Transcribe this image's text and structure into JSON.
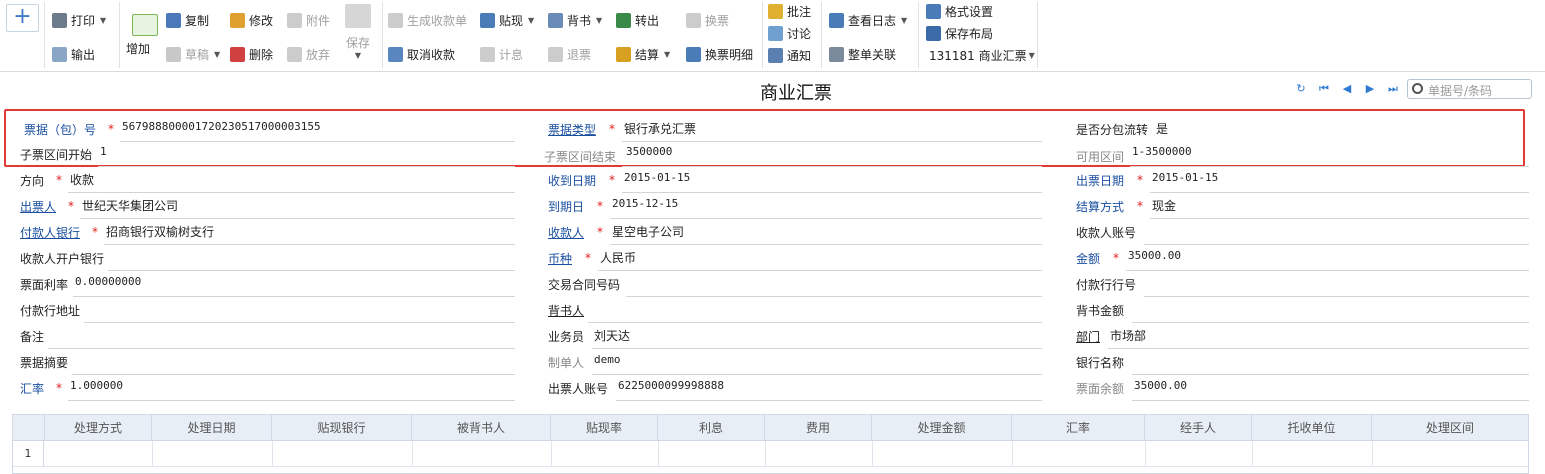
{
  "toolbar": {
    "print": "打印",
    "export": "输出",
    "add": "增加",
    "copy": "复制",
    "draft": "草稿",
    "modify": "修改",
    "delete": "删除",
    "attachment": "附件",
    "abandon": "放弃",
    "save": "保存",
    "gen_receipt": "生成收款单",
    "cancel_receipt": "取消收款",
    "discount": "贴现",
    "interest": "计息",
    "endorse": "背书",
    "return_bill": "退票",
    "transfer_out": "转出",
    "settle": "结算",
    "exchange": "换票",
    "exchange_detail": "换票明细",
    "annotate": "批注",
    "discuss": "讨论",
    "notify": "通知",
    "view_log": "查看日志",
    "full_link": "整单关联",
    "format_setting": "格式设置",
    "save_layout": "保存布局",
    "template": "131181 商业汇票"
  },
  "page_title": "商业汇票",
  "search": {
    "placeholder": "单据号/条码"
  },
  "fields": {
    "bill_no": {
      "label": "票据（包）号",
      "value": "567988800001720230517000003155"
    },
    "bill_type": {
      "label": "票据类型",
      "value": "银行承兑汇票"
    },
    "split_transfer": {
      "label": "是否分包流转",
      "value": "是"
    },
    "sub_start": {
      "label": "子票区间开始",
      "value": "1"
    },
    "sub_end": {
      "label": "子票区间结束",
      "value": "3500000"
    },
    "avail_range": {
      "label": "可用区间",
      "value": "1-3500000"
    },
    "direction": {
      "label": "方向",
      "value": "收款"
    },
    "receive_date": {
      "label": "收到日期",
      "value": "2015-01-15"
    },
    "issue_date": {
      "label": "出票日期",
      "value": "2015-01-15"
    },
    "drawer": {
      "label": "出票人",
      "value": "世纪天华集团公司"
    },
    "due_date": {
      "label": "到期日",
      "value": "2015-12-15"
    },
    "settle_method": {
      "label": "结算方式",
      "value": "现金"
    },
    "payer_bank": {
      "label": "付款人银行",
      "value": "招商银行双榆树支行"
    },
    "payee": {
      "label": "收款人",
      "value": "星空电子公司"
    },
    "payee_account": {
      "label": "收款人账号",
      "value": ""
    },
    "payee_bank": {
      "label": "收款人开户银行",
      "value": ""
    },
    "currency": {
      "label": "币种",
      "value": "人民币"
    },
    "amount": {
      "label": "金额",
      "value": "35000.00"
    },
    "face_rate": {
      "label": "票面利率",
      "value": "0.00000000"
    },
    "contract_no": {
      "label": "交易合同号码",
      "value": ""
    },
    "pay_bank_no": {
      "label": "付款行行号",
      "value": ""
    },
    "pay_bank_addr": {
      "label": "付款行地址",
      "value": ""
    },
    "endorser": {
      "label": "背书人",
      "value": ""
    },
    "endorse_amount": {
      "label": "背书金额",
      "value": ""
    },
    "remark": {
      "label": "备注",
      "value": ""
    },
    "salesman": {
      "label": "业务员",
      "value": "刘天达"
    },
    "department": {
      "label": "部门",
      "value": "市场部"
    },
    "summary": {
      "label": "票据摘要",
      "value": ""
    },
    "maker": {
      "label": "制单人",
      "value": "demo"
    },
    "bank_name": {
      "label": "银行名称",
      "value": ""
    },
    "exchange_rate": {
      "label": "汇率",
      "value": "1.000000"
    },
    "drawer_account": {
      "label": "出票人账号",
      "value": "6225000099998888"
    },
    "face_balance": {
      "label": "票面余额",
      "value": "35000.00"
    }
  },
  "grid": {
    "columns": [
      "处理方式",
      "处理日期",
      "贴现银行",
      "被背书人",
      "贴现率",
      "利息",
      "费用",
      "处理金额",
      "汇率",
      "经手人",
      "托收单位",
      "处理区间"
    ],
    "rows": [
      "1"
    ]
  },
  "colors": {
    "accent": "#2f7ad2",
    "required": "#e02020",
    "highlight_border": "#e53935"
  }
}
